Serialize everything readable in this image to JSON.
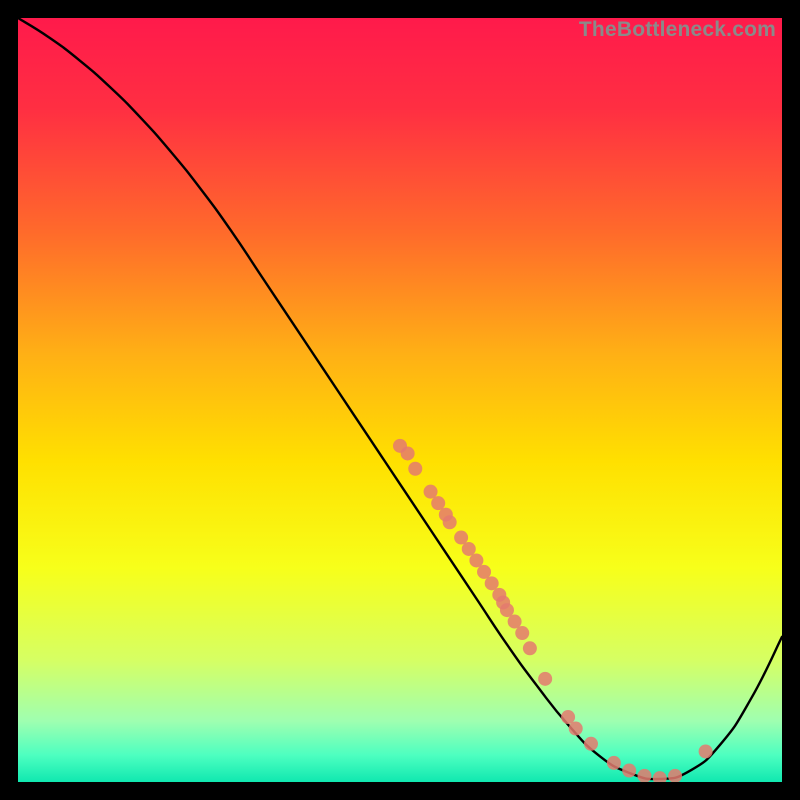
{
  "watermark": "TheBottleneck.com",
  "chart_data": {
    "type": "line",
    "title": "",
    "xlabel": "",
    "ylabel": "",
    "xlim": [
      0,
      100
    ],
    "ylim": [
      0,
      100
    ],
    "background_gradient": {
      "stops": [
        {
          "offset": 0.0,
          "color": "#ff1a4b"
        },
        {
          "offset": 0.12,
          "color": "#ff2f42"
        },
        {
          "offset": 0.28,
          "color": "#ff6a2b"
        },
        {
          "offset": 0.44,
          "color": "#ffb015"
        },
        {
          "offset": 0.58,
          "color": "#ffe000"
        },
        {
          "offset": 0.72,
          "color": "#f7ff1a"
        },
        {
          "offset": 0.84,
          "color": "#d6ff63"
        },
        {
          "offset": 0.92,
          "color": "#9fffb0"
        },
        {
          "offset": 0.965,
          "color": "#4dffc0"
        },
        {
          "offset": 1.0,
          "color": "#10e8b0"
        }
      ]
    },
    "series": [
      {
        "name": "bottleneck-curve",
        "type": "line",
        "x": [
          0,
          4,
          8,
          12,
          16,
          20,
          24,
          28,
          32,
          36,
          40,
          44,
          48,
          52,
          56,
          60,
          64,
          68,
          72,
          76,
          80,
          84,
          88,
          92,
          96,
          100
        ],
        "y": [
          100,
          97.5,
          94.5,
          91,
          87,
          82.5,
          77.5,
          72,
          66,
          60,
          54,
          48,
          42,
          36,
          30,
          24,
          18,
          12.5,
          7.5,
          3.5,
          1.2,
          0.4,
          1.5,
          5,
          11,
          19
        ]
      },
      {
        "name": "sample-points",
        "type": "scatter",
        "x": [
          50,
          51,
          52,
          54,
          55,
          56,
          56.5,
          58,
          59,
          60,
          61,
          62,
          63,
          63.5,
          64,
          65,
          66,
          67,
          69,
          72,
          73,
          75,
          78,
          80,
          82,
          84,
          86,
          90
        ],
        "y": [
          44,
          43,
          41,
          38,
          36.5,
          35,
          34,
          32,
          30.5,
          29,
          27.5,
          26,
          24.5,
          23.5,
          22.5,
          21,
          19.5,
          17.5,
          13.5,
          8.5,
          7,
          5,
          2.5,
          1.5,
          0.8,
          0.5,
          0.8,
          4
        ]
      }
    ]
  }
}
